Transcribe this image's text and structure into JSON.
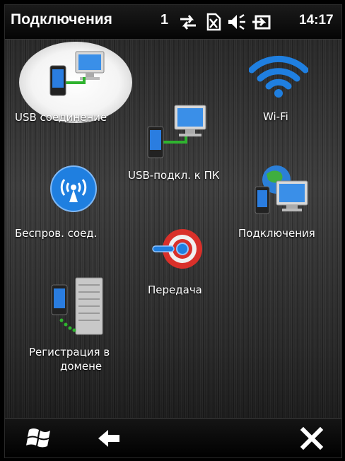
{
  "status_bar": {
    "title": "Подключения",
    "signal_number": "1",
    "time": "14:17",
    "icons": [
      "data-transfer-icon",
      "no-sim-icon",
      "volume-icon",
      "battery-charging-icon"
    ]
  },
  "tiles": [
    {
      "label": "USB соединение",
      "icon": "usb-connection-icon",
      "selected": true
    },
    {
      "label": "Wi-Fi",
      "icon": "wifi-icon"
    },
    {
      "label": "USB-подкл. к ПК",
      "icon": "usb-to-pc-icon"
    },
    {
      "label": "Беспров. соед.",
      "icon": "wireless-icon"
    },
    {
      "label": "Подключения",
      "icon": "connections-icon"
    },
    {
      "label": "Передача",
      "icon": "beam-transfer-icon"
    },
    {
      "label_line1": "Регистрация в",
      "label_line2": "домене",
      "icon": "domain-enroll-icon"
    }
  ],
  "bottom_bar": {
    "buttons": [
      "start-windows-icon",
      "back-arrow-icon",
      "close-icon"
    ]
  },
  "colors": {
    "accent_blue": "#1f7fe0",
    "green_cable": "#2fb32f",
    "red_beam": "#d9302a"
  }
}
